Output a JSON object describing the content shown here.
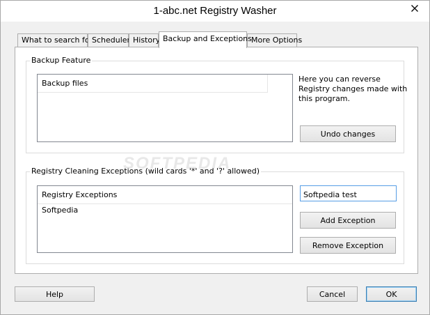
{
  "window": {
    "title": "1-abc.net Registry Washer"
  },
  "tabs": [
    {
      "label": "What to search for"
    },
    {
      "label": "Scheduler"
    },
    {
      "label": "History"
    },
    {
      "label": "Backup and Exceptions"
    },
    {
      "label": "More Options"
    }
  ],
  "backup": {
    "group_label": "Backup Feature",
    "list_header": "Backup files",
    "info_lines": [
      "Here you can reverse",
      "Registry changes made with",
      "this program."
    ],
    "undo_button": "Undo changes"
  },
  "exceptions": {
    "group_label": "Registry Cleaning Exceptions (wild cards '*' and '?' allowed)",
    "list_header": "Registry Exceptions",
    "items": [
      "Softpedia"
    ],
    "input_value": "Softpedia test",
    "add_button": "Add Exception",
    "remove_button": "Remove Exception"
  },
  "footer": {
    "help_button": "Help",
    "cancel_button": "Cancel",
    "ok_button": "OK"
  },
  "watermark": "SOFTPEDIA"
}
